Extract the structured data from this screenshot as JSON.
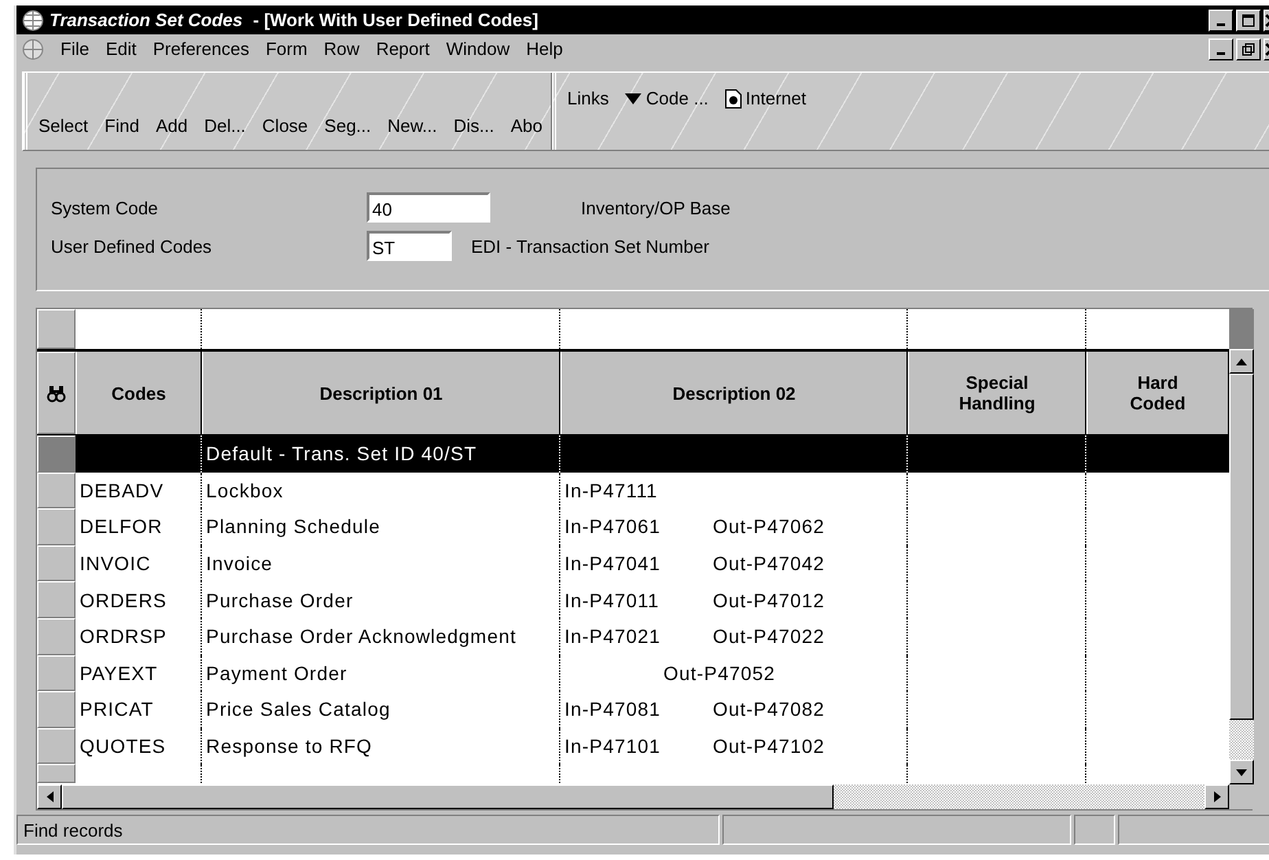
{
  "window": {
    "title": "Transaction Set Codes",
    "subtitle": " - [Work With User Defined Codes]"
  },
  "menu": [
    "File",
    "Edit",
    "Preferences",
    "Form",
    "Row",
    "Report",
    "Window",
    "Help"
  ],
  "toolbar": {
    "buttons": [
      "Select",
      "Find",
      "Add",
      "Del...",
      "Close",
      "Seg...",
      "New...",
      "Dis...",
      "Abo"
    ],
    "links": "Links",
    "code": "Code ...",
    "internet": "Internet"
  },
  "form": {
    "fields": [
      {
        "label": "System Code",
        "value": "40",
        "description": "Inventory/OP Base"
      },
      {
        "label": "User Defined Codes",
        "value": "ST",
        "description": "EDI - Transaction Set Number"
      }
    ]
  },
  "table": {
    "columns": [
      "Codes",
      "Description 01",
      "Description 02",
      "Special Handling",
      "Hard Coded"
    ],
    "rows": [
      {
        "code": "",
        "description_01": "Default - Trans. Set ID 40/ST",
        "in": "",
        "out": "",
        "selected": true
      },
      {
        "code": "DEBADV",
        "description_01": "Lockbox",
        "in": "In-P47111",
        "out": "",
        "selected": false
      },
      {
        "code": "DELFOR",
        "description_01": "Planning Schedule",
        "in": "In-P47061",
        "out": "Out-P47062",
        "selected": false
      },
      {
        "code": "INVOIC",
        "description_01": "Invoice",
        "in": "In-P47041",
        "out": "Out-P47042",
        "selected": false
      },
      {
        "code": "ORDERS",
        "description_01": "Purchase Order",
        "in": "In-P47011",
        "out": "Out-P47012",
        "selected": false
      },
      {
        "code": "ORDRSP",
        "description_01": "Purchase Order Acknowledgment",
        "in": "In-P47021",
        "out": "Out-P47022",
        "selected": false
      },
      {
        "code": "PAYEXT",
        "description_01": "Payment Order",
        "in": "",
        "out": "Out-P47052",
        "selected": false
      },
      {
        "code": "PRICAT",
        "description_01": "Price Sales Catalog",
        "in": "In-P47081",
        "out": "Out-P47082",
        "selected": false
      },
      {
        "code": "QUOTES",
        "description_01": "Response to RFQ",
        "in": "In-P47101",
        "out": "Out-P47102",
        "selected": false
      }
    ]
  },
  "status_bar": "Find records"
}
